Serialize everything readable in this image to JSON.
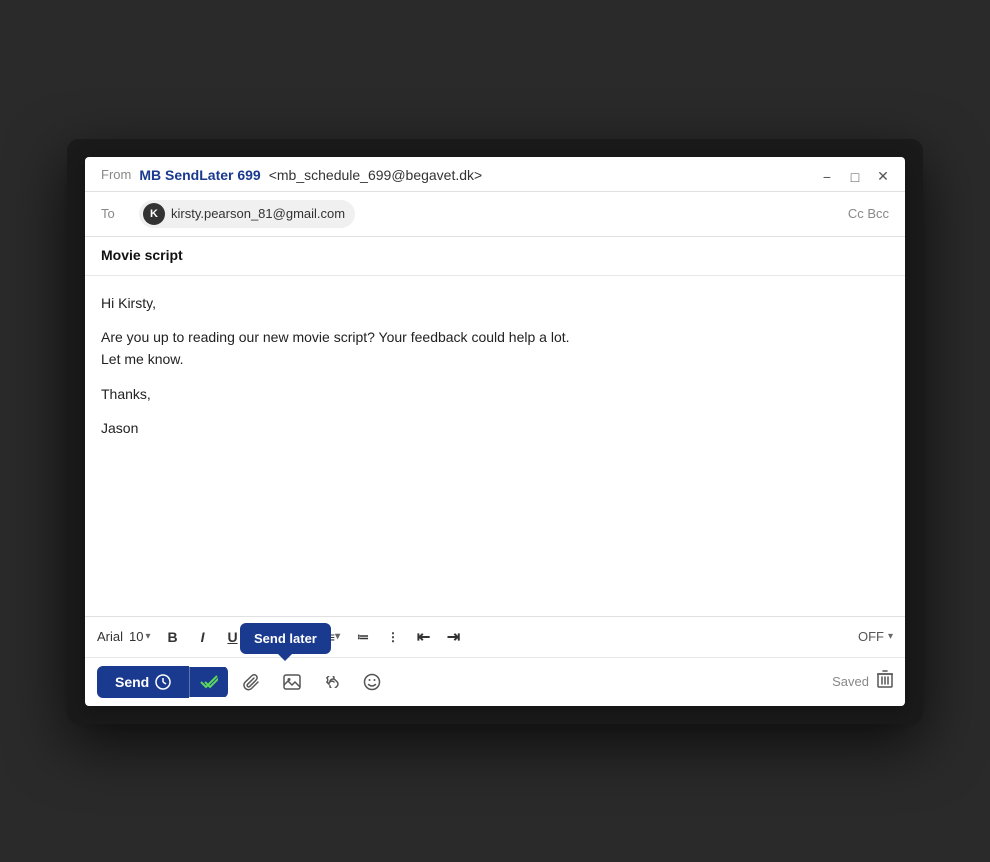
{
  "window": {
    "title_bar": {
      "minimize_label": "−",
      "maximize_label": "□",
      "close_label": "✕"
    },
    "from_row": {
      "label": "From",
      "sender_name": "MB SendLater 699",
      "sender_email": "<mb_schedule_699@begavet.dk>"
    },
    "to_row": {
      "label": "To",
      "recipient_initial": "K",
      "recipient_email": "kirsty.pearson_81@gmail.com",
      "cc_bcc": "Cc Bcc"
    },
    "subject": "Movie script",
    "body_lines": [
      "Hi Kirsty,",
      "",
      "Are you up to reading our new movie script? Your feedback could help a lot.",
      "Let me know.",
      "",
      "Thanks,",
      "",
      "Jason"
    ],
    "toolbar": {
      "font_name": "Arial",
      "font_size": "10",
      "bold": "B",
      "italic": "I",
      "underline": "U",
      "off_label": "OFF"
    },
    "action_bar": {
      "send_label": "Send",
      "send_later_tooltip": "Send later",
      "saved_label": "Saved"
    }
  }
}
